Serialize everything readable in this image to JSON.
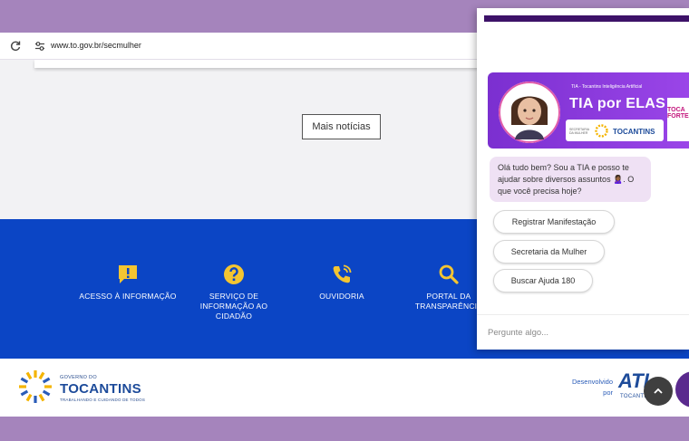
{
  "browser": {
    "url": "www.to.gov.br/secmulher"
  },
  "main": {
    "more_news_label": "Mais notícias"
  },
  "service_links": [
    {
      "label": "ACESSO À INFORMAÇÃO",
      "icon": "info-alert-icon"
    },
    {
      "label": "SERVIÇO DE INFORMAÇÃO AO CIDADÃO",
      "icon": "question-icon"
    },
    {
      "label": "OUVIDORIA",
      "icon": "phone-icon"
    },
    {
      "label": "PORTAL DA TRANSPARÊNCIA",
      "icon": "search-icon"
    }
  ],
  "footer": {
    "logo_small": "GOVERNO DO",
    "logo_name": "TOCANTINS",
    "logo_tagline": "TRABALHANDO E CUIDANDO DE TODOS",
    "developed_by_line1": "Desenvolvido",
    "developed_by_line2": "por",
    "ati_mark": "ATI",
    "ati_sub": "TOCANTINS"
  },
  "chat": {
    "banner_small": "TIA - Tocantins Inteligência Artificial",
    "banner_title": "TIA por ELAS",
    "banner_card_small": "SECRETARIA DA MULHER",
    "banner_card_name": "TOCANTINS",
    "banner_side": "TOCA FORTES",
    "greeting": "Olá tudo bem? Sou a TIA e posso te ajudar sobre diversos assuntos 🙎🏾‍♀️. O que você precisa hoje?",
    "quick_replies": [
      "Registrar Manifestação",
      "Secretaria da Mulher",
      "Buscar Ajuda 180"
    ],
    "input_placeholder": "Pergunte algo..."
  },
  "colors": {
    "page_border": "#a584bc",
    "blue_band": "#0b45c5",
    "service_icon": "#f4c531",
    "chat_accent": "#3d1268",
    "bot_bubble": "#efe1f4"
  }
}
